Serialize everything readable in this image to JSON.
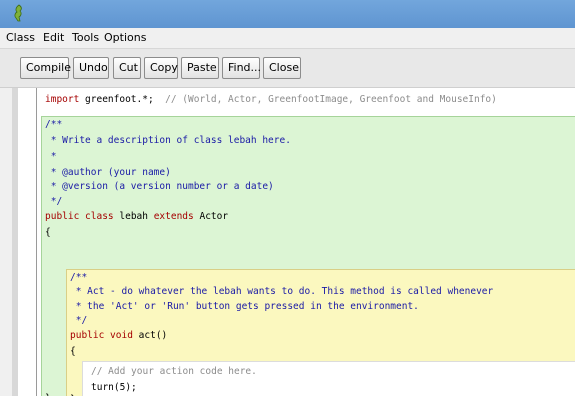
{
  "menubar": {
    "items": [
      "Class",
      "Edit",
      "Tools",
      "Options"
    ]
  },
  "toolbar": {
    "compile": "Compile",
    "undo": "Undo",
    "cut": "Cut",
    "copy": "Copy",
    "paste": "Paste",
    "find": "Find...",
    "close": "Close"
  },
  "code": {
    "import_kw": "import",
    "import_rest": " greenfoot.*;  ",
    "import_comment": "// (World, Actor, GreenfootImage, Greenfoot and MouseInfo)",
    "doc": [
      "/**",
      " * Write a description of class lebah here.",
      " *",
      " * @author (your name)",
      " * @version (a version number or a date)",
      " */"
    ],
    "class_public": "public",
    "class_kw": " class",
    "class_name": " lebah ",
    "extends_kw": "extends",
    "super_name": " Actor",
    "open_brace": "{",
    "method_doc": [
      "/**",
      " * Act - do whatever the lebah wants to do. This method is called whenever",
      " * the 'Act' or 'Run' button gets pressed in the environment.",
      " */"
    ],
    "method_public": "public",
    "method_void": " void",
    "method_name": " act()",
    "method_open": "{",
    "body_comment": "// Add your action code here.",
    "body_stmt": "turn(5);",
    "method_close": "}",
    "class_close": "}"
  },
  "colors": {
    "class_scope": "#dcf5d4",
    "method_scope": "#fbf8bf",
    "keyword": "#a50000",
    "doc_comment": "#1a1aa6"
  },
  "icons": {
    "app": "greenfoot-icon"
  }
}
